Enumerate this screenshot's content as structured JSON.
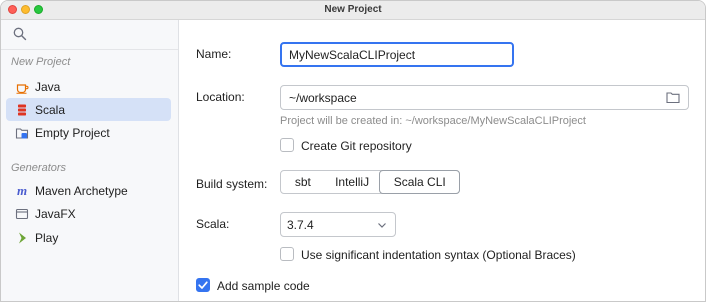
{
  "window": {
    "title": "New Project"
  },
  "sidebar": {
    "search_placeholder": "",
    "new_project_label": "New Project",
    "new_project_items": [
      {
        "label": "Java",
        "icon": "java-cup-icon"
      },
      {
        "label": "Scala",
        "icon": "scala-icon",
        "selected": true
      },
      {
        "label": "Empty Project",
        "icon": "empty-project-icon"
      }
    ],
    "generators_label": "Generators",
    "generator_items": [
      {
        "label": "Maven Archetype",
        "icon": "maven-icon"
      },
      {
        "label": "JavaFX",
        "icon": "javafx-window-icon"
      },
      {
        "label": "Play",
        "icon": "play-icon"
      }
    ]
  },
  "form": {
    "name_label": "Name:",
    "name_value": "MyNewScalaCLIProject",
    "location_label": "Location:",
    "location_value": "~/workspace",
    "location_hint": "Project will be created in: ~/workspace/MyNewScalaCLIProject",
    "git_label": "Create Git repository",
    "git_checked": false,
    "build_system_label": "Build system:",
    "build_systems": [
      "sbt",
      "IntelliJ",
      "Scala CLI"
    ],
    "build_system_selected": "Scala CLI",
    "scala_label": "Scala:",
    "scala_version": "3.7.4",
    "indentation_label": "Use significant indentation syntax (Optional Braces)",
    "indentation_checked": false,
    "sample_code_label": "Add sample code",
    "sample_code_checked": true
  },
  "colors": {
    "accent": "#3574f0",
    "selection": "#d5e1f7",
    "scala_red": "#de3423",
    "java_orange": "#e76f00",
    "maven_blue": "#4a5ccf",
    "play_green": "#6da536"
  }
}
